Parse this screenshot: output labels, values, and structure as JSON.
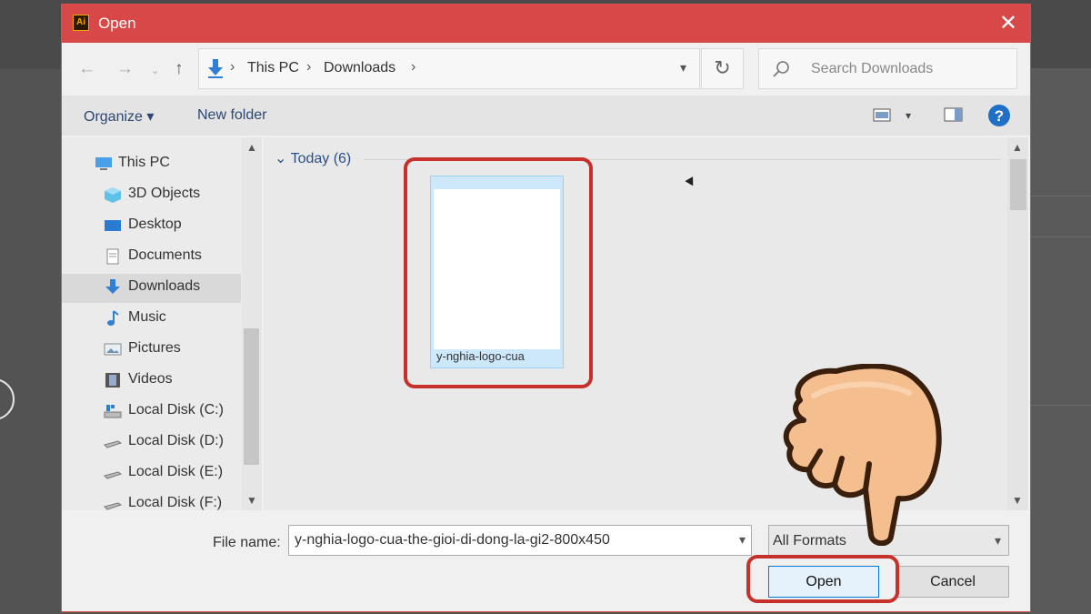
{
  "dialog": {
    "title": "Open",
    "app_icon_text": "Ai"
  },
  "address": {
    "crumbs": [
      "This PC",
      "Downloads"
    ]
  },
  "search": {
    "placeholder": "Search Downloads"
  },
  "commandbar": {
    "organize": "Organize",
    "new_folder": "New folder"
  },
  "navpane": {
    "items": [
      {
        "label": "This PC",
        "icon": "computer-icon"
      },
      {
        "label": "3D Objects",
        "icon": "cube-icon"
      },
      {
        "label": "Desktop",
        "icon": "desktop-icon"
      },
      {
        "label": "Documents",
        "icon": "document-icon"
      },
      {
        "label": "Downloads",
        "icon": "download-icon",
        "selected": true
      },
      {
        "label": "Music",
        "icon": "music-icon"
      },
      {
        "label": "Pictures",
        "icon": "pictures-icon"
      },
      {
        "label": "Videos",
        "icon": "film-icon"
      },
      {
        "label": "Local Disk (C:)",
        "icon": "drive-icon"
      },
      {
        "label": "Local Disk (D:)",
        "icon": "drive-icon"
      },
      {
        "label": "Local Disk (E:)",
        "icon": "drive-icon"
      },
      {
        "label": "Local Disk (F:)",
        "icon": "drive-icon"
      }
    ]
  },
  "filepane": {
    "group_header": "Today (6)",
    "selected_file_caption": "y-nghia-logo-cua"
  },
  "footer": {
    "file_name_label": "File name:",
    "file_name_value": "y-nghia-logo-cua-the-gioi-di-dong-la-gi2-800x450",
    "format_value": "All Formats",
    "open_label": "Open",
    "cancel_label": "Cancel"
  },
  "colors": {
    "titlebar": "#d94848",
    "highlight": "#c7312b",
    "accent": "#0078d7"
  }
}
